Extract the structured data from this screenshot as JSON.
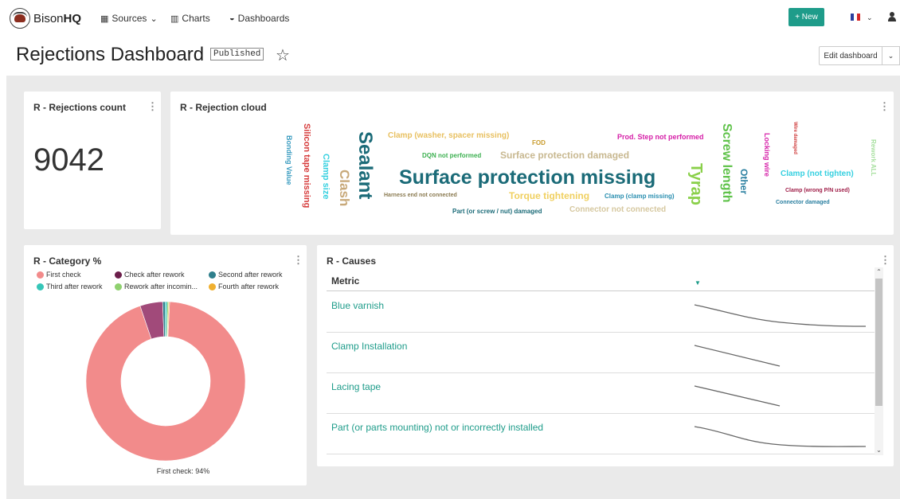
{
  "app": {
    "logo_prefix": "Bison",
    "logo_suffix": "HQ"
  },
  "nav": {
    "sources": "Sources",
    "charts": "Charts",
    "dashboards": "Dashboards"
  },
  "header": {
    "new_button": "+ New"
  },
  "page": {
    "title": "Rejections Dashboard",
    "status": "Published",
    "edit_button": "Edit dashboard"
  },
  "widgets": {
    "count": {
      "title": "R - Rejections count",
      "value": "9042"
    },
    "cloud": {
      "title": "R - Rejection cloud",
      "words": [
        "Surface protection missing",
        "Sealant",
        "Tyrap",
        "Screw length",
        "Clash",
        "Silicon tape missing",
        "Bonding Value",
        "Clamp size",
        "Clamp (washer, spacer missing)",
        "FOD",
        "Prod. Step not performed",
        "DQN not performed",
        "Surface protection damaged",
        "Torque tightening",
        "Clamp (clamp missing)",
        "Harness end not connected",
        "Connector not connected",
        "Part (or screw / nut) damaged",
        "Other",
        "Locking wire",
        "Wire damaged",
        "Clamp (not tighten)",
        "Clamp (wrong P/N used)",
        "Connector damaged",
        "Rework ALL"
      ]
    },
    "category": {
      "title": "R - Category %",
      "legend": [
        "First check",
        "Check after rework",
        "Second after rework",
        "Third after rework",
        "Rework after incomin...",
        "Fourth after rework"
      ],
      "label": "First check: 94%"
    },
    "causes": {
      "title": "R - Causes",
      "column": "Metric",
      "rows": [
        "Blue varnish",
        "Clamp Installation",
        "Lacing tape",
        "Part (or parts mounting) not or incorrectly installed"
      ]
    }
  },
  "chart_data": {
    "type": "pie",
    "title": "R - Category %",
    "categories": [
      "First check",
      "Check after rework",
      "Second after rework",
      "Third after rework",
      "Rework after incomin...",
      "Fourth after rework"
    ],
    "values": [
      94,
      4.6,
      0.5,
      0.4,
      0.3,
      0.2
    ],
    "colors": [
      "#f28b8b",
      "#a14a7a",
      "#2f7f8c",
      "#36c6b8",
      "#8fd16f",
      "#f0b030"
    ],
    "legend": "top-left"
  },
  "colors": {
    "accent": "#1e9c8a"
  },
  "icons": [
    "logo-icon",
    "table-icon",
    "bar-chart-icon",
    "dashboard-icon",
    "star-icon",
    "user-icon",
    "flag-fr-icon",
    "kebab-icon"
  ]
}
